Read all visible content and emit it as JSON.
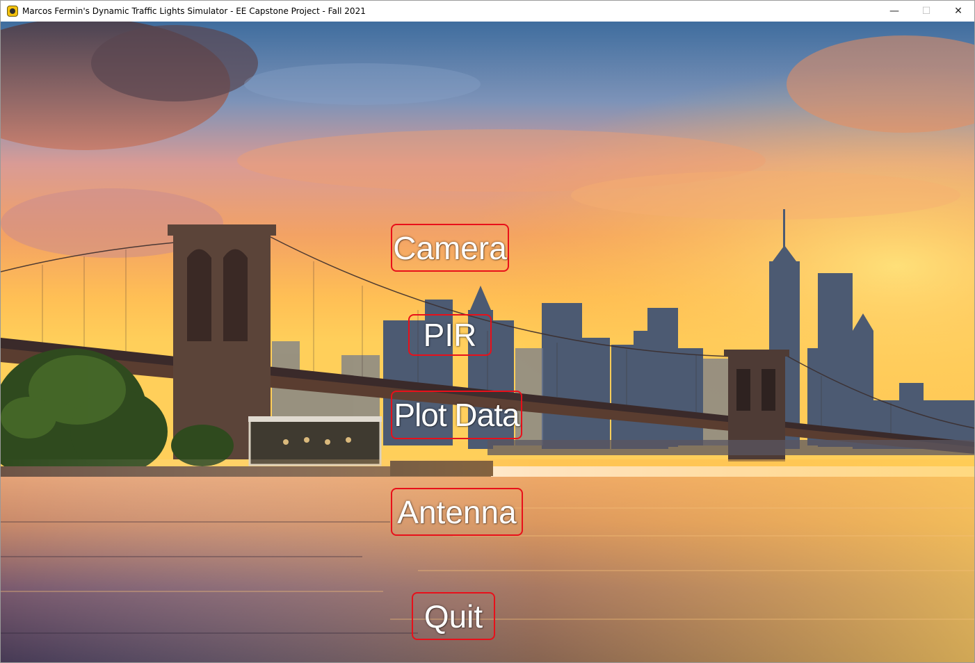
{
  "window": {
    "title": "Marcos Fermin's Dynamic Traffic Lights Simulator - EE Capstone Project - Fall 2021",
    "icon": "pygame-snake-icon",
    "controls": {
      "minimize": "—",
      "maximize": "☐",
      "close": "✕"
    }
  },
  "background": {
    "description_icon": "city-skyline-sunset-image",
    "colors": {
      "sky_top": "#3d6a9c",
      "sky_mid": "#f09a5a",
      "horizon": "#ffb347",
      "water": "#5a4a5a",
      "water_glow": "#e89040",
      "button_border": "#e8101a"
    }
  },
  "menu": {
    "camera": "Camera",
    "pir": "PIR",
    "plot_data": "Plot Data",
    "antenna": "Antenna",
    "quit": "Quit"
  }
}
